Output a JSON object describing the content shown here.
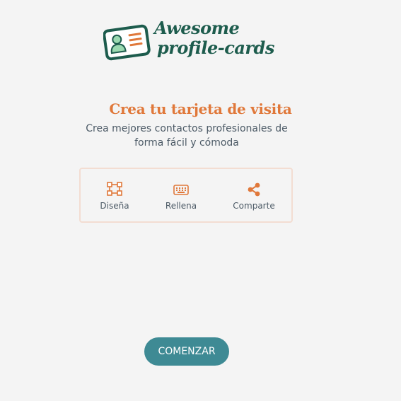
{
  "brand": {
    "line1": "Awesome",
    "line2": "profile-cards",
    "icon": "id-card-icon",
    "colors": {
      "dark_green": "#1d5c4d",
      "light_green": "#9ad9b0",
      "orange": "#e0783a"
    }
  },
  "hero": {
    "title": "Crea tu tarjeta de visita",
    "subtitle": "Crea mejores contactos profesionales de forma fácil y cómoda"
  },
  "features": [
    {
      "label": "Diseña",
      "icon": "vector-design-icon"
    },
    {
      "label": "Rellena",
      "icon": "keyboard-icon"
    },
    {
      "label": "Comparte",
      "icon": "share-icon"
    }
  ],
  "cta": {
    "label": "COMENZAR",
    "color": "#3e8a94"
  },
  "theme": {
    "background": "#f4f4f4",
    "accent": "#e0783a",
    "text": "#4c5a66"
  }
}
